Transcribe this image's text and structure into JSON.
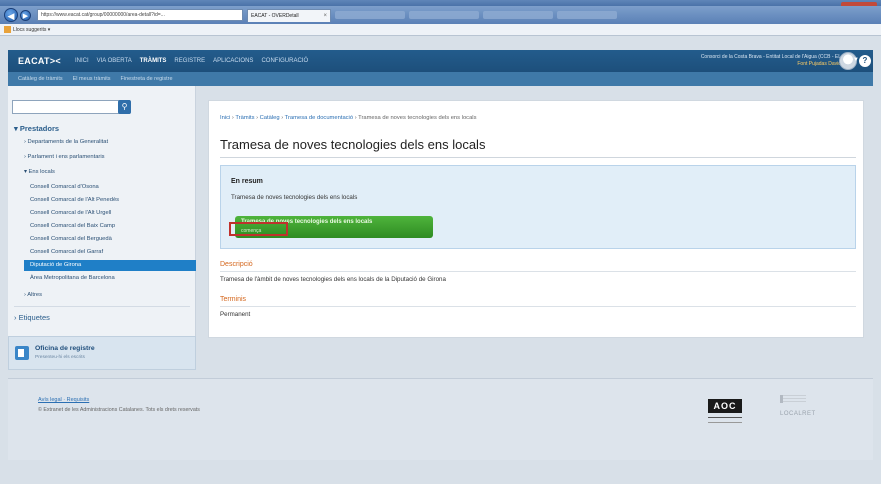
{
  "browser": {
    "url": "https://www.eacat.cat/group/00000000/area-detall?id=...",
    "tab_title": "EACAT - OVERDetall",
    "favorites_label": "Llocs suggerits ▾"
  },
  "header": {
    "logo": "EACAT><",
    "menu": [
      "INICI",
      "VIA OBERTA",
      "TRÀMITS",
      "REGISTRE",
      "APLICACIONS",
      "CONFIGURACIÓ"
    ],
    "active_menu": "TRÀMITS",
    "entity": "Consorci de la Costa Brava - Entitat Local de l'Aigua (CCB - EL",
    "user": "Font Pujadas David",
    "help": "?"
  },
  "subnav": [
    "Catàleg de tràmits",
    "El meus tràmits",
    "Finestreta de registre"
  ],
  "sidebar": {
    "search_icon": "search-icon",
    "prestadors_title": "Prestadors",
    "items": [
      "Departaments de la Generalitat",
      "Parlament i ens parlamentaris",
      "Ens locals"
    ],
    "ens_locals": [
      "Consell Comarcal d'Osona",
      "Consell Comarcal de l'Alt Penedès",
      "Consell Comarcal de l'Alt Urgell",
      "Consell Comarcal del Baix Camp",
      "Consell Comarcal del Berguedà",
      "Consell Comarcal del Garraf",
      "Diputació de Girona",
      "Àrea Metropolitana de Barcelona"
    ],
    "altres": "Altres",
    "etiquetes": "Etiquetes",
    "office_title": "Oficina de registre",
    "office_sub": "Presenteu-hi els escrits"
  },
  "main": {
    "breadcrumb": [
      "Inici",
      "Tràmits",
      "Catàleg",
      "Tramesa de documentació",
      "Tramesa de noves tecnologies dels ens locals"
    ],
    "title": "Tramesa de noves tecnologies dels ens locals",
    "resum_title": "En resum",
    "resum_desc": "Tramesa de noves tecnologies dels ens locals",
    "button_label": "Tramesa de noves tecnologies dels ens locals",
    "button_sub": "comença",
    "descripcio_title": "Descripció",
    "descripcio_text": "Tramesa de l'àmbit de noves tecnologies dels ens locals de la Diputació de Girona",
    "terminis_title": "Terminis",
    "terminis_text": "Permanent"
  },
  "footer": {
    "links": "Avís legal · Requisits",
    "copyright": "© Extranet de les Administracions Catalanes. Tots els drets reservats",
    "aoc": "AOC",
    "localret": "LOCALRET"
  },
  "colors": {
    "header_bg": "#1d4f7b",
    "selected_item": "#1f7fc7",
    "button_green": "#3a9e2c",
    "highlight_red": "#c0312c",
    "section_orange": "#d4661c"
  }
}
